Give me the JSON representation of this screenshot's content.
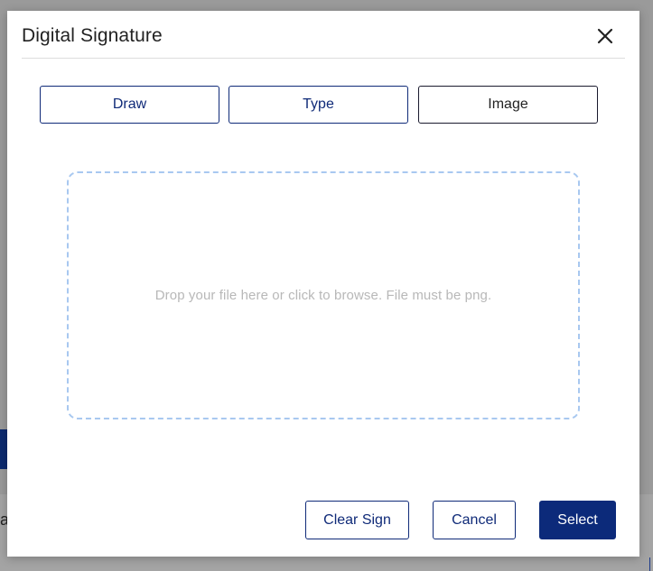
{
  "modal": {
    "title": "Digital Signature",
    "close_icon": "close-icon"
  },
  "tabs": [
    {
      "label": "Draw"
    },
    {
      "label": "Type"
    },
    {
      "label": "Image"
    }
  ],
  "dropzone": {
    "text": "Drop your file here or click to browse. File must be png."
  },
  "footer": {
    "clear_label": "Clear Sign",
    "cancel_label": "Cancel",
    "select_label": "Select"
  },
  "background": {
    "partial_text": "a"
  },
  "colors": {
    "primary": "#0c2a7a",
    "dropzone_border": "#a8c8f0",
    "dropzone_text": "#b8b8b8"
  }
}
